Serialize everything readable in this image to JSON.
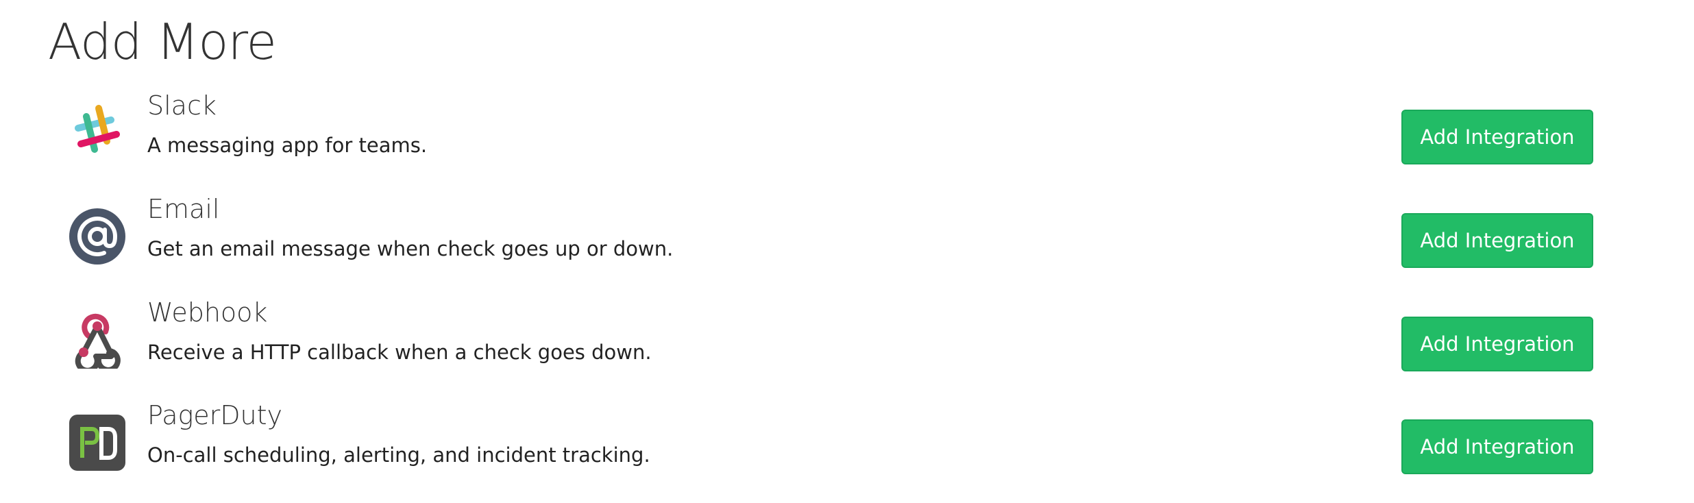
{
  "page_title": "Add More",
  "integrations": [
    {
      "name": "Slack",
      "description": "A messaging app for teams.",
      "icon": "slack-icon",
      "button_label": "Add Integration"
    },
    {
      "name": "Email",
      "description": "Get an email message when check goes up or down.",
      "icon": "email-icon",
      "button_label": "Add Integration"
    },
    {
      "name": "Webhook",
      "description": "Receive a HTTP callback when a check goes down.",
      "icon": "webhook-icon",
      "button_label": "Add Integration"
    },
    {
      "name": "PagerDuty",
      "description": "On-call scheduling, alerting, and incident tracking.",
      "icon": "pagerduty-icon",
      "icon_text": "PD",
      "button_label": "Add Integration"
    }
  ],
  "colors": {
    "button_bg": "#22bc66",
    "button_border": "#1aa95a",
    "email_icon_bg": "#4a5568",
    "webhook_magenta": "#c73a63",
    "webhook_dark": "#4b4b4b",
    "pagerduty_bg": "#4a4a4a",
    "pagerduty_green": "#7ac143",
    "slack_teal": "#6ecadc",
    "slack_yellow": "#e9a820",
    "slack_green": "#3eb991",
    "slack_red": "#e01563"
  }
}
